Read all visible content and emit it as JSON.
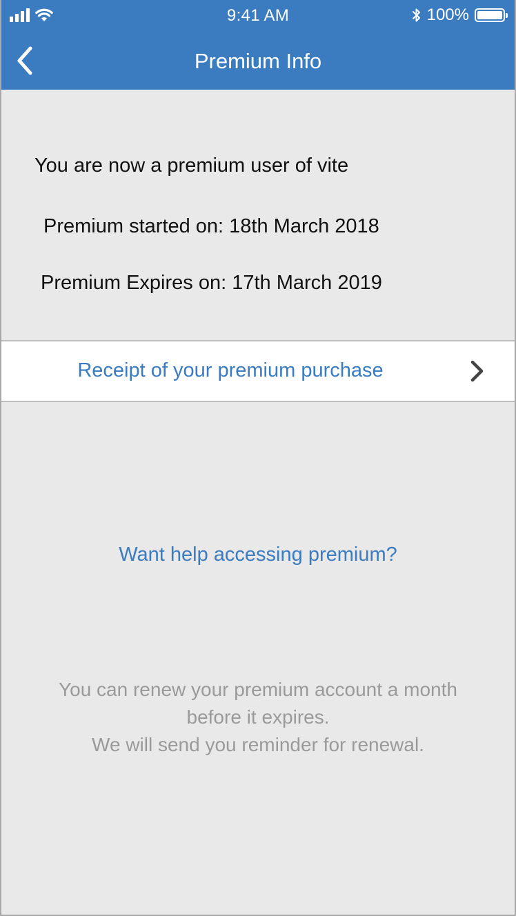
{
  "status_bar": {
    "time": "9:41 AM",
    "battery_text": "100%",
    "icons": [
      "signal-icon",
      "wifi-icon",
      "bluetooth-icon",
      "battery-icon"
    ]
  },
  "nav": {
    "title": "Premium Info",
    "back_icon": "chevron-left-icon"
  },
  "info": {
    "line_1": "You are now a premium user of vite",
    "line_2": "Premium started on: 18th March 2018",
    "line_3": "Premium Expires on: 17th March 2019"
  },
  "receipt": {
    "label": "Receipt of your premium purchase",
    "icon": "chevron-right-icon"
  },
  "help": {
    "link": "Want help accessing premium?"
  },
  "renew": {
    "line_1": "You can renew your premium account a month",
    "line_2": "before it expires.",
    "line_3": "We will send you reminder for renewal."
  },
  "colors": {
    "header_bg": "#3b7bc0",
    "page_bg": "#e9e9e9",
    "link": "#3b7bc0",
    "muted_text": "#9a9a9a",
    "body_text": "#111111"
  }
}
